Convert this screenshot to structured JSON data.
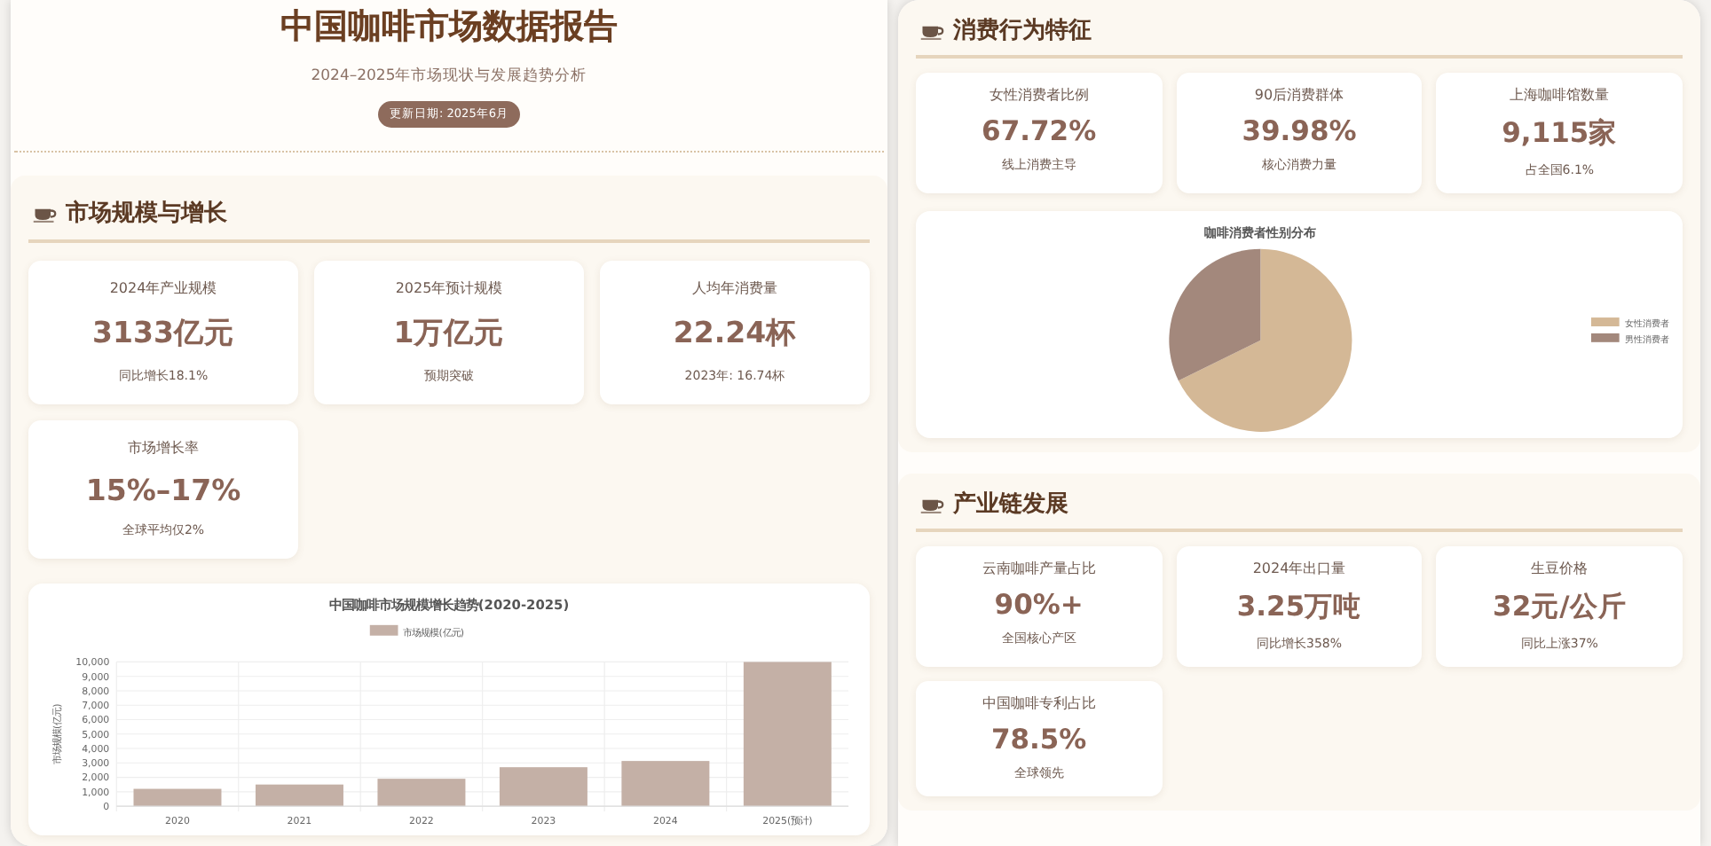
{
  "left_panel": {
    "header": {
      "title": "中国咖啡市场数据报告",
      "subtitle": "2024–2025年市场现状与发展趋势分析",
      "update_badge": "更新日期: 2025年6月"
    },
    "sections": [
      {
        "title": "市场规模与增长",
        "cards": [
          {
            "label": "2024年产业规模",
            "value": "3133亿元",
            "note": "同比增长18.1%"
          },
          {
            "label": "2025年预计规模",
            "value": "1万亿元",
            "note": "预期突破"
          },
          {
            "label": "人均年消费量",
            "value": "22.24杯",
            "note": "2023年: 16.74杯"
          },
          {
            "label": "市场增长率",
            "value": "15%–17%",
            "note": "全球平均仅2%"
          }
        ],
        "chart_data": {
          "type": "bar",
          "title": "中国咖啡市场规模增长趋势(2020-2025)",
          "ylabel": "市场规模(亿元)",
          "categories": [
            "2020",
            "2021",
            "2022",
            "2023",
            "2024",
            "2025(预计)"
          ],
          "series": [
            {
              "name": "市场规模(亿元)",
              "color": "#c4b0a6",
              "values": [
                1200,
                1500,
                1900,
                2700,
                3133,
                10000
              ]
            }
          ],
          "grid": true,
          "legend": true,
          "ylim": [
            0,
            10000
          ],
          "yticks": [
            {
              "value": 0,
              "label": "0"
            },
            {
              "value": 1000,
              "label": "1,000"
            },
            {
              "value": 2000,
              "label": "2,000"
            },
            {
              "value": 3000,
              "label": "3,000"
            },
            {
              "value": 4000,
              "label": "4,000"
            },
            {
              "value": 5000,
              "label": "5,000"
            },
            {
              "value": 6000,
              "label": "6,000"
            },
            {
              "value": 7000,
              "label": "7,000"
            },
            {
              "value": 8000,
              "label": "8,000"
            },
            {
              "value": 9000,
              "label": "9,000"
            },
            {
              "value": 10000,
              "label": "10,000"
            }
          ]
        }
      }
    ]
  },
  "right_panel": {
    "sections": [
      {
        "title": "消费行为特征",
        "cards": [
          {
            "label": "女性消费者比例",
            "value": "67.72%",
            "note": "线上消费主导"
          },
          {
            "label": "90后消费群体",
            "value": "39.98%",
            "note": "核心消费力量"
          },
          {
            "label": "上海咖啡馆数量",
            "value": "9,115家",
            "note": "占全国6.1%"
          }
        ],
        "chart_data": {
          "type": "pie",
          "title": "咖啡消费者性别分布",
          "categories": [
            "女性消费者",
            "男性消费者"
          ],
          "values": [
            67.72,
            32.28
          ],
          "colors": [
            "#d4b896",
            "#a3887c"
          ],
          "legend": true
        }
      },
      {
        "title": "产业链发展",
        "cards": [
          {
            "label": "云南咖啡产量占比",
            "value": "90%+",
            "note": "全国核心产区"
          },
          {
            "label": "2024年出口量",
            "value": "3.25万吨",
            "note": "同比增长358%"
          },
          {
            "label": "生豆价格",
            "value": "32元/公斤",
            "note": "同比上涨37%"
          },
          {
            "label": "中国咖啡专利占比",
            "value": "78.5%",
            "note": "全球领先"
          }
        ]
      }
    ]
  }
}
